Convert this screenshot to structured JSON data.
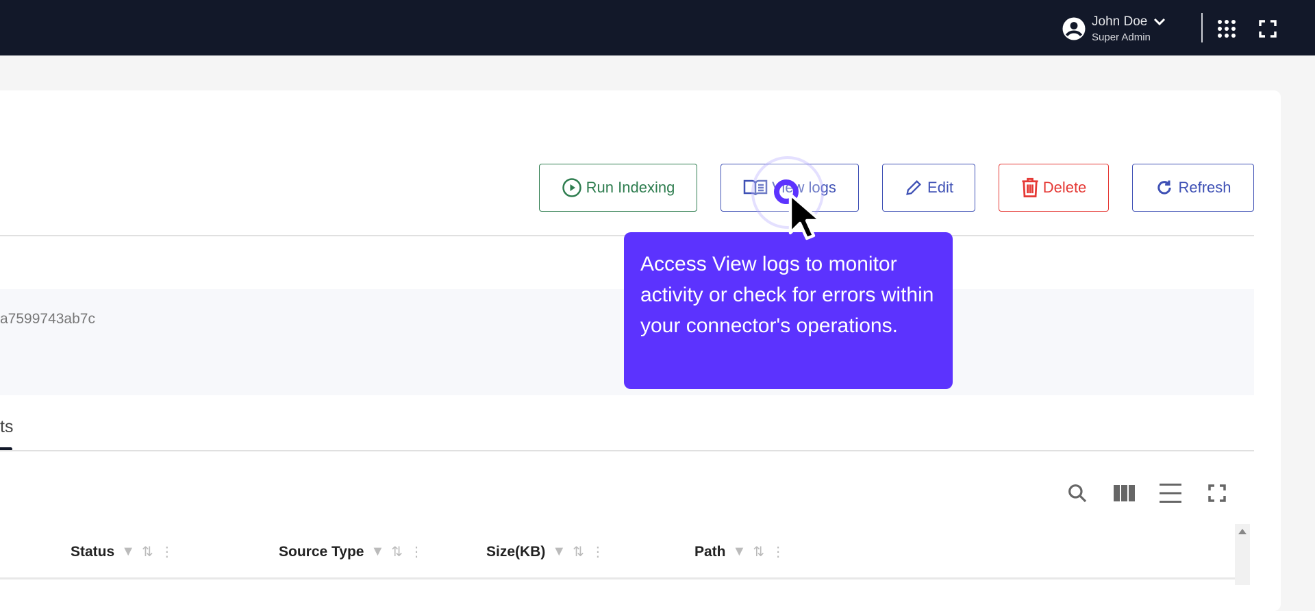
{
  "header": {
    "user_name": "John Doe",
    "user_role": "Super Admin"
  },
  "actions": {
    "run_indexing": "Run Indexing",
    "view_logs": "View logs",
    "edit": "Edit",
    "delete": "Delete",
    "refresh": "Refresh"
  },
  "info": {
    "id_fragment": "a7599743ab7c"
  },
  "tab": {
    "label": "ts"
  },
  "table": {
    "columns": [
      "Status",
      "Source Type",
      "Size(KB)",
      "Path"
    ]
  },
  "tooltip": {
    "text": "Access View logs to monitor activity or check for errors within your connector's operations."
  },
  "colors": {
    "topbar": "#121829",
    "tooltip": "#5c33fe",
    "primary": "#3f51b5",
    "success": "#2e7d4f",
    "danger": "#e53935"
  }
}
